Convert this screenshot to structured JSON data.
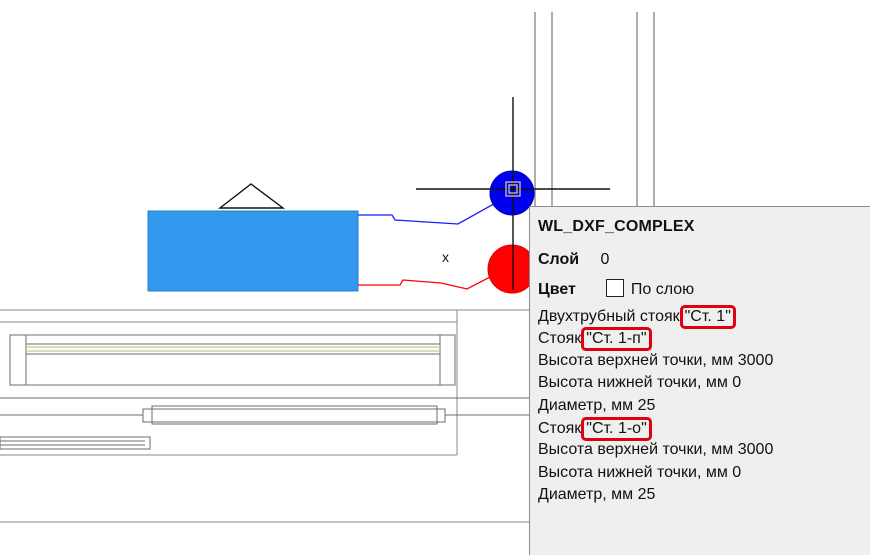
{
  "drawing": {
    "text_marker": "x"
  },
  "tooltip": {
    "title": "WL_DXF_COMPLEX",
    "layer_label": "Слой",
    "layer_value": "0",
    "color_label": "Цвет",
    "color_value": "По слою",
    "lines": [
      {
        "text": "Двухтрубный стояк",
        "tag": "\"Ст. 1\""
      },
      {
        "text": "Стояк",
        "tag": "\"Ст. 1-п\""
      },
      {
        "text": "Высота верхней точки, мм 3000"
      },
      {
        "text": "Высота нижней точки, мм 0"
      },
      {
        "text": "Диаметр, мм 25"
      },
      {
        "text": "Стояк",
        "tag": "\"Ст. 1-о\""
      },
      {
        "text": "Высота верхней точки, мм 3000"
      },
      {
        "text": "Высота нижней точки, мм 0"
      },
      {
        "text": "Диаметр, мм 25"
      }
    ]
  },
  "colors": {
    "supply_pipe": "#1a1aff",
    "return_pipe": "#ff0000",
    "radiator": "#3399ee",
    "highlight": "#e0000e",
    "tooltip_bg": "#efefef"
  }
}
